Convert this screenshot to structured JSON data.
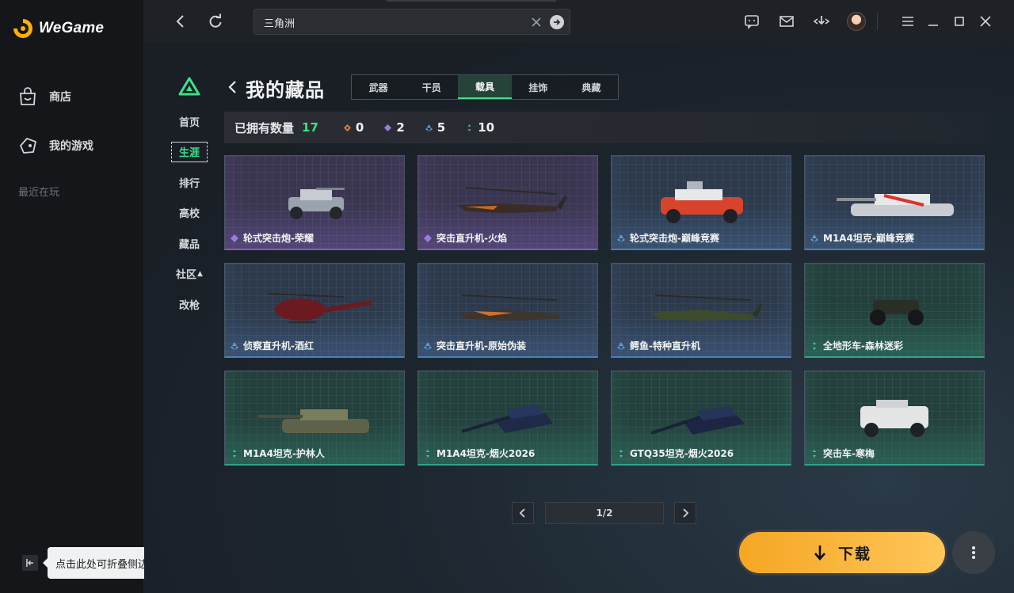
{
  "app": {
    "name": "WeGame"
  },
  "sidebar": {
    "items": [
      {
        "label": "商店",
        "icon": "store-bag-icon"
      },
      {
        "label": "我的游戏",
        "icon": "gamepad-icon"
      }
    ],
    "recent_label": "最近在玩",
    "collapse_tooltip": "点击此处可折叠侧边栏"
  },
  "topbar": {
    "search_value": "三角洲",
    "icons": [
      "back-icon",
      "refresh-icon",
      "chat-icon",
      "mail-icon",
      "download-manager-icon",
      "avatar",
      "menu-icon",
      "minimize-icon",
      "maximize-icon",
      "close-icon"
    ]
  },
  "game_nav": {
    "items": [
      "首页",
      "生涯",
      "排行",
      "高校",
      "藏品",
      "社区",
      "改枪"
    ],
    "active": "生涯"
  },
  "page": {
    "title": "我的藏品"
  },
  "tabs": {
    "items": [
      "武器",
      "干员",
      "载具",
      "挂饰",
      "典藏"
    ],
    "active": "载具"
  },
  "stats": {
    "label": "已拥有数量",
    "total": "17",
    "rarities": [
      {
        "color": "#e07a3a",
        "count": "0"
      },
      {
        "color": "#9b7be0",
        "count": "2"
      },
      {
        "color": "#5b9be0",
        "count": "5"
      },
      {
        "color": "#3ec9a0",
        "count": "10"
      }
    ]
  },
  "items": [
    {
      "name": "轮式突击炮-荣耀",
      "rarity": "purple"
    },
    {
      "name": "突击直升机-火焰",
      "rarity": "purple"
    },
    {
      "name": "轮式突击炮-巅峰竞赛",
      "rarity": "blue"
    },
    {
      "name": "M1A4坦克-巅峰竞赛",
      "rarity": "blue"
    },
    {
      "name": "侦察直升机-酒红",
      "rarity": "blue"
    },
    {
      "name": "突击直升机-原始伪装",
      "rarity": "blue"
    },
    {
      "name": "鳄鱼-特种直升机",
      "rarity": "blue"
    },
    {
      "name": "全地形车-森林迷彩",
      "rarity": "green"
    },
    {
      "name": "M1A4坦克-护林人",
      "rarity": "green"
    },
    {
      "name": "M1A4坦克-烟火2026",
      "rarity": "green"
    },
    {
      "name": "GTQ35坦克-烟火2026",
      "rarity": "green"
    },
    {
      "name": "突击车-寒梅",
      "rarity": "green"
    }
  ],
  "pagination": {
    "text": "1/2"
  },
  "download": {
    "label": "下载"
  }
}
